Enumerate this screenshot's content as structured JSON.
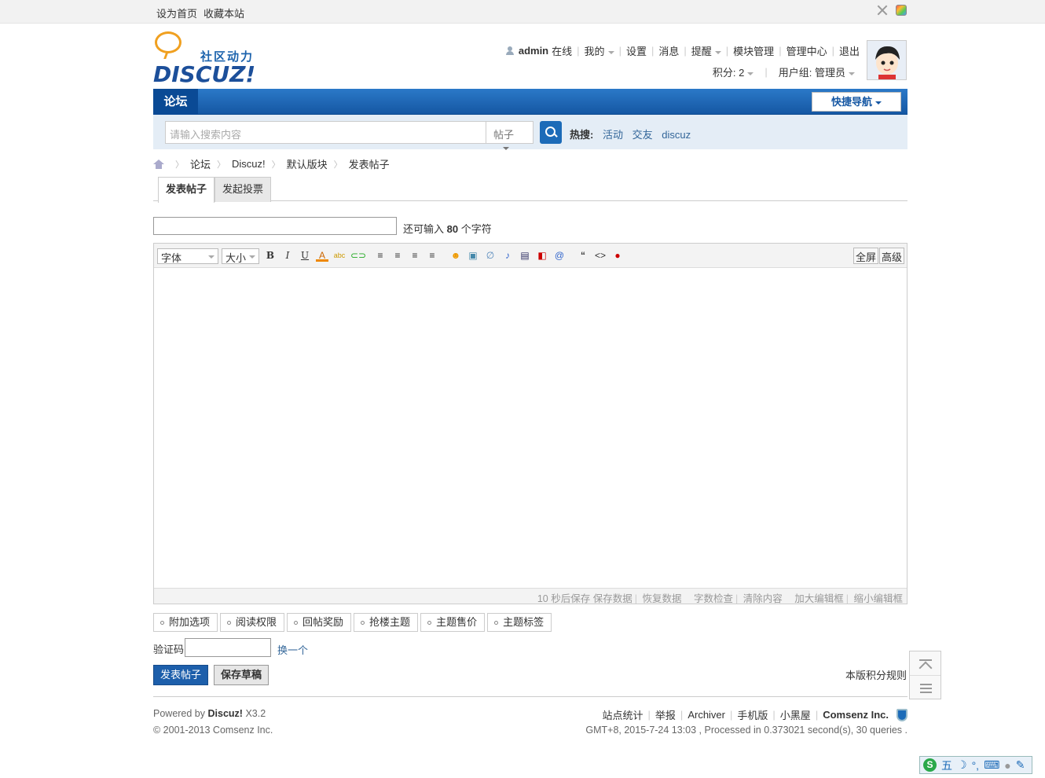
{
  "topbar": {
    "set_home": "设为首页",
    "bookmark": "收藏本站"
  },
  "logo": {
    "cn": "社区动力",
    "en": "DISCUZ!"
  },
  "user": {
    "name": "admin",
    "status": "在线",
    "mine": "我的",
    "settings": "设置",
    "messages": "消息",
    "reminders": "提醒",
    "module_mgmt": "模块管理",
    "admin_center": "管理中心",
    "logout": "退出",
    "credits": "积分: 2",
    "group": "用户组: 管理员"
  },
  "nav": {
    "forum": "论坛",
    "quick_nav": "快捷导航"
  },
  "search": {
    "placeholder": "请输入搜索内容",
    "type": "帖子",
    "hot_label": "热搜:",
    "hot": [
      "活动",
      "交友",
      "discuz"
    ]
  },
  "breadcrumb": [
    "论坛",
    "Discuz!",
    "默认版块",
    "发表帖子"
  ],
  "tabs": [
    "发表帖子",
    "发起投票"
  ],
  "title_counter": {
    "prefix": "还可输入",
    "num": "80",
    "suffix": "个字符"
  },
  "editor": {
    "font": "字体",
    "size": "大小",
    "fullscreen": "全屏",
    "advanced": "高级",
    "status": {
      "autosave": "10 秒后保存",
      "save": "保存数据",
      "restore": "恢复数据",
      "check": "字数检查",
      "clear": "清除内容",
      "enlarge": "加大编辑框",
      "shrink": "缩小编辑框"
    }
  },
  "options": [
    "附加选项",
    "阅读权限",
    "回帖奖励",
    "抢楼主题",
    "主题售价",
    "主题标签"
  ],
  "captcha": {
    "label": "验证码",
    "change": "换一个"
  },
  "buttons": {
    "post": "发表帖子",
    "draft": "保存草稿"
  },
  "rules": "本版积分规则",
  "footer": {
    "powered": "Powered by",
    "brand": "Discuz!",
    "version": "X3.2",
    "copyright": "© 2001-2013 Comsenz Inc.",
    "links": [
      "站点统计",
      "举报",
      "Archiver",
      "手机版",
      "小黑屋"
    ],
    "company": "Comsenz Inc.",
    "stats": "GMT+8, 2015-7-24 13:03 , Processed in 0.373021 second(s), 30 queries ."
  },
  "ime": {
    "mode": "五"
  }
}
